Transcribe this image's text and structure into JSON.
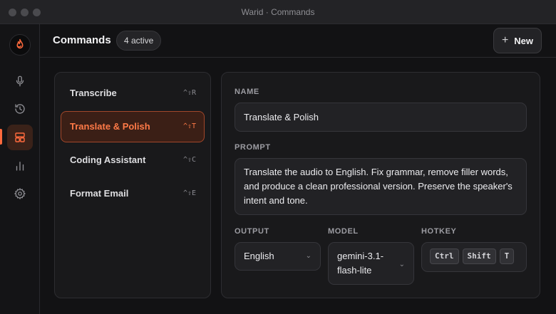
{
  "window": {
    "title": "Warid · Commands"
  },
  "header": {
    "title": "Commands",
    "badge": "4 active",
    "new_button_label": "New",
    "new_button_icon": "plus-icon"
  },
  "rail": {
    "logo_icon": "flame-logo-icon",
    "items": [
      {
        "name": "microphone",
        "icon": "microphone-icon",
        "active": false
      },
      {
        "name": "history",
        "icon": "history-icon",
        "active": false
      },
      {
        "name": "commands",
        "icon": "layout-icon",
        "active": true
      },
      {
        "name": "stats",
        "icon": "bar-chart-icon",
        "active": false
      },
      {
        "name": "settings",
        "icon": "gear-icon",
        "active": false
      }
    ]
  },
  "commands": [
    {
      "label": "Transcribe",
      "shortcut": "^⇧R",
      "selected": false
    },
    {
      "label": "Translate & Polish",
      "shortcut": "^⇧T",
      "selected": true
    },
    {
      "label": "Coding Assistant",
      "shortcut": "^⇧C",
      "selected": false
    },
    {
      "label": "Format Email",
      "shortcut": "^⇧E",
      "selected": false
    }
  ],
  "detail": {
    "name_label": "NAME",
    "name_value": "Translate & Polish",
    "prompt_label": "PROMPT",
    "prompt_value": "Translate the audio to English. Fix grammar, remove filler words, and produce a clean professional version. Preserve the speaker's intent and tone.",
    "output_label": "OUTPUT",
    "output_value": "English",
    "model_label": "MODEL",
    "model_value": "gemini-3.1-flash-lite",
    "hotkey_label": "HOTKEY",
    "hotkey_keys": [
      "Ctrl",
      "Shift",
      "T"
    ]
  },
  "colors": {
    "accent": "#ff6a3d",
    "selected_bg": "#3b1f16"
  }
}
